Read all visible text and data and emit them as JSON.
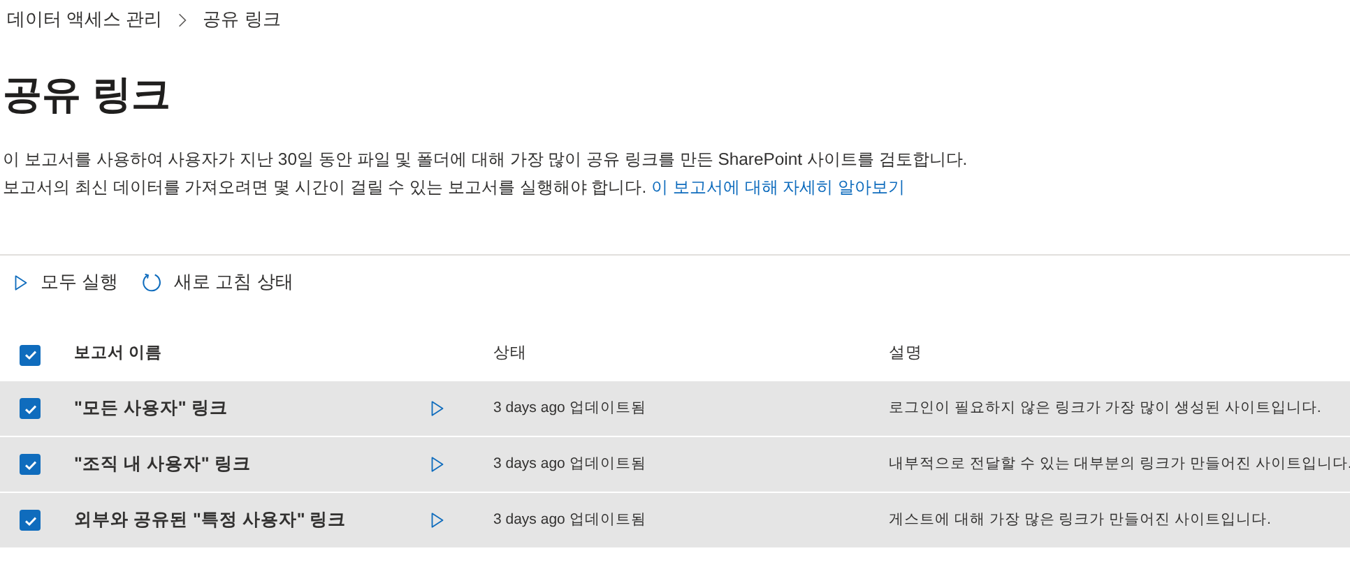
{
  "breadcrumb": [
    {
      "label": "데이터 액세스 관리"
    },
    {
      "label": "공유 링크"
    }
  ],
  "title": "공유 링크",
  "description": {
    "text": "이 보고서를 사용하여 사용자가 지난 30일 동안 파일 및 폴더에 대해 가장 많이 공유 링크를 만든 SharePoint 사이트를 검토합니다. 보고서의 최신 데이터를 가져오려면 몇 시간이 걸릴 수 있는 보고서를 실행해야 합니다.",
    "link": "이 보고서에 대해 자세히 알아보기"
  },
  "toolbar": [
    {
      "kind": "run",
      "label": "모두 실행"
    },
    {
      "kind": "refresh",
      "label": "새로 고침 상태"
    }
  ],
  "table": {
    "all_selected": true,
    "columns": [
      "보고서 이름",
      "상태",
      "설명"
    ],
    "rows": [
      {
        "selected": true,
        "name": "\"모든 사용자\" 링크",
        "status": "3 days ago 업데이트됨",
        "description": "로그인이 필요하지 않은 링크가 가장 많이 생성된 사이트입니다."
      },
      {
        "selected": true,
        "name": "\"조직 내 사용자\" 링크",
        "status": "3 days ago 업데이트됨",
        "description": "내부적으로 전달할 수 있는 대부분의 링크가 만들어진 사이트입니다."
      },
      {
        "selected": true,
        "name": "외부와 공유된 \"특정 사용자\" 링크",
        "status": "3 days ago 업데이트됨",
        "description": "게스트에 대해 가장 많은 링크가 만들어진 사이트입니다."
      }
    ]
  }
}
